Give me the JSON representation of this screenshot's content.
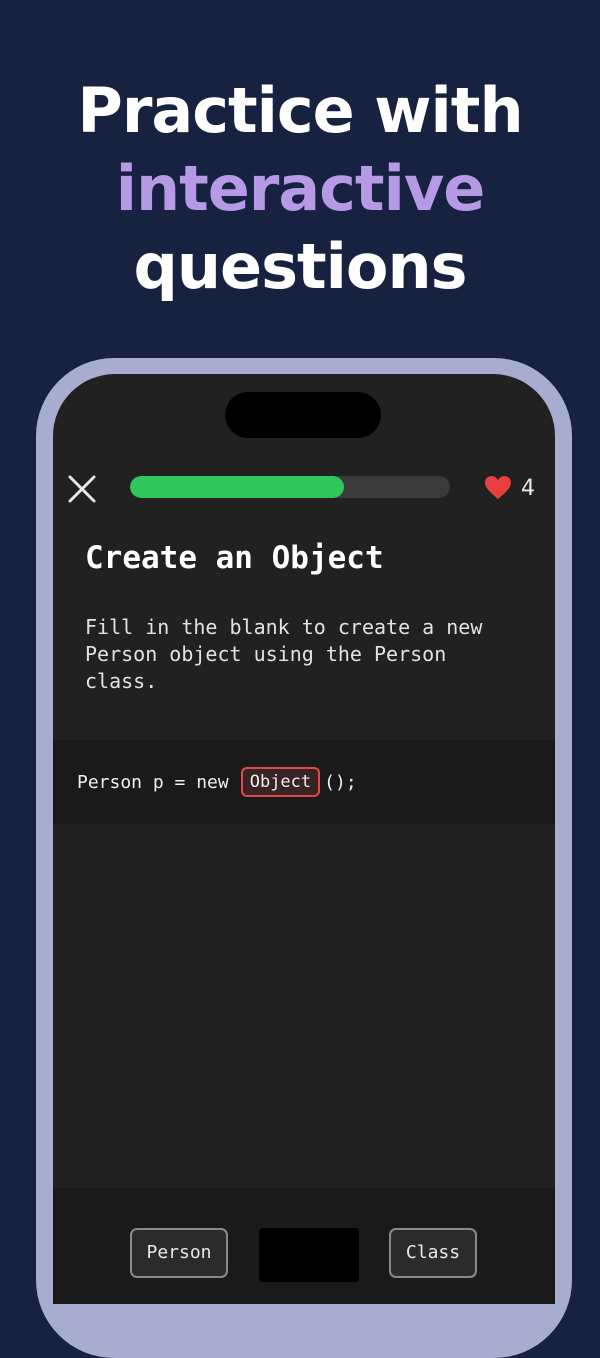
{
  "headline": {
    "line1": "Practice with",
    "line2": "interactive",
    "line3": "questions"
  },
  "colors": {
    "background": "#172240",
    "accent": "#b79ae6",
    "phone_frame": "#a7acd1",
    "progress": "#2fc65b",
    "heart": "#e84040",
    "blank_border": "#e04a4a"
  },
  "lesson": {
    "close_icon": "close-icon",
    "progress_fraction": 0.67,
    "lives_icon": "heart-icon",
    "lives": "4",
    "title": "Create an Object",
    "prompt": "Fill in the blank to create a new Person object using the Person class.",
    "code": {
      "before": "Person p = new",
      "blank": "Object",
      "after": "();"
    },
    "options": [
      "Person",
      "",
      "Class"
    ]
  }
}
